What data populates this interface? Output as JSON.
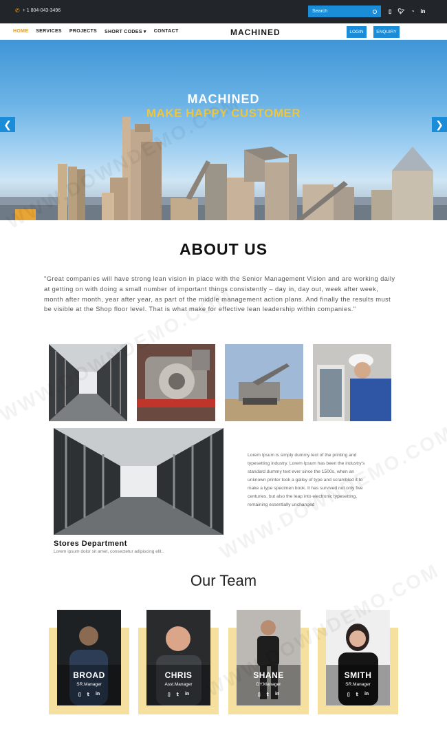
{
  "topbar": {
    "phone": "+ 1 804-043-3496",
    "phone_icon": "phone-icon",
    "search_placeholder": "Search",
    "social_icons": [
      "mobile-icon",
      "twitter-icon",
      "rss-icon",
      "linkedin-icon"
    ]
  },
  "nav": {
    "items": [
      "HOME",
      "SERVICES",
      "PROJECTS",
      "SHORT CODES",
      "CONTACT"
    ],
    "active": "HOME",
    "brand": "MACHINED",
    "login": "LOGIN",
    "enquiry": "ENQUIRY"
  },
  "hero": {
    "title": "MACHINED",
    "subtitle": "MAKE HAPPY CUSTOMER",
    "prev": "❮",
    "next": "❯"
  },
  "about": {
    "title": "ABOUT US",
    "text": "\"Great companies will have strong lean vision in place with the Senior Management Vision and are working daily at getting on with doing a small number of important things consistently – day in, day out, week after week, month after month, year after year, as part of the middle management action plans. And finally the results must be visible at the Shop floor level. That is what make for effective lean leadership within companies.\""
  },
  "feature": {
    "text": "Lorem Ipsum is simply dummy text of the printing and typesetting industry. Lorem Ipsum has been the industry's standard dummy text ever since the 1500s, when an unknown printer took a galley of type and scrambled it to make a type specimen book. It has survived not only five centuries, but also the leap into electronic typesetting, remaining essentially unchanged",
    "title": "Stores Department",
    "subtitle": "Lorem ipsum dolor sit amet, consectetur adipiscing elit.."
  },
  "team": {
    "title": "Our Team",
    "members": [
      {
        "name": "BROAD",
        "role": "SR.Manager"
      },
      {
        "name": "CHRIS",
        "role": "Asst.Manager"
      },
      {
        "name": "SHANE",
        "role": "DY.Manager"
      },
      {
        "name": "SMITH",
        "role": "SR.Manager"
      }
    ]
  },
  "watermark": "WWW.DOWNDEMO.COM",
  "colors": {
    "accent_blue": "#1a8cd8",
    "accent_gold": "#f0c53a",
    "card_bg": "#f6e0a0",
    "topbar": "#22252a"
  }
}
